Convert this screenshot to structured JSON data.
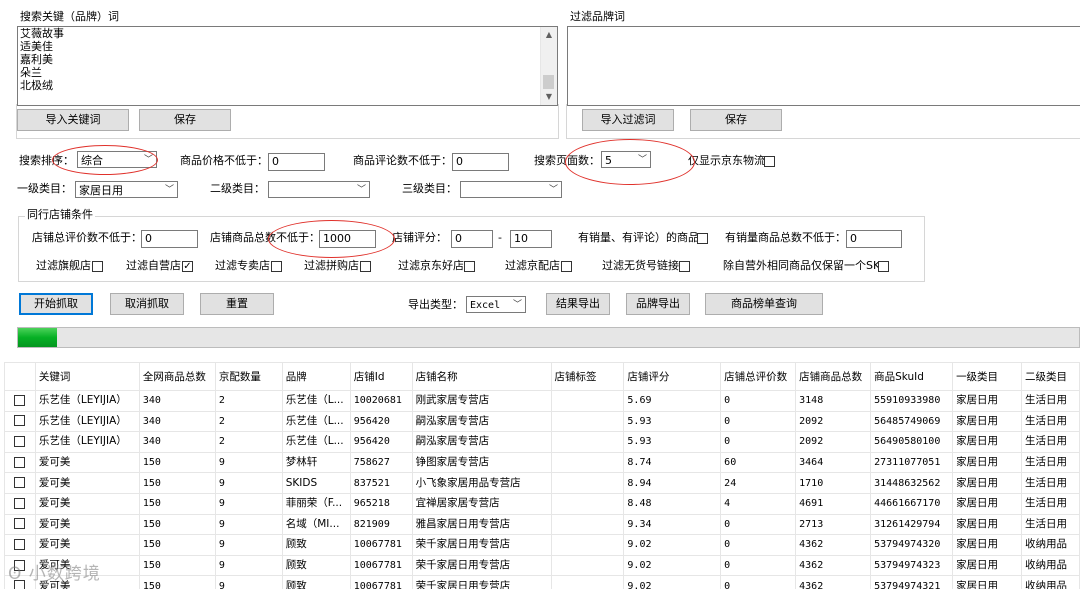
{
  "keywords": {
    "label": "搜索关键（品牌）词",
    "items": [
      "艾薇故事",
      "适美佳",
      "嘉利美",
      "朵兰",
      "北极绒"
    ],
    "import_button": "导入关键词",
    "save_button": "保存"
  },
  "filter_brands": {
    "label": "过滤品牌词",
    "import_button": "导入过滤词",
    "save_button": "保存"
  },
  "search": {
    "sort_label": "搜索排序：",
    "sort_value": "综合",
    "min_price_label": "商品价格不低于：",
    "min_price_value": "0",
    "min_reviews_label": "商品评论数不低于：",
    "min_reviews_value": "0",
    "pages_label": "搜索页面数：",
    "pages_value": "5",
    "jd_logistics_label": "仅显示京东物流"
  },
  "categories": {
    "level1_label": "一级类目：",
    "level1_value": "家居日用",
    "level2_label": "二级类目：",
    "level2_value": "",
    "level3_label": "三级类目：",
    "level3_value": ""
  },
  "peer_shop": {
    "group_label": "同行店铺条件",
    "total_reviews_label": "店铺总评价数不低于：",
    "total_reviews_value": "0",
    "total_products_label": "店铺商品总数不低于：",
    "total_products_value": "1000",
    "score_label": "店铺评分：",
    "score_min": "0",
    "score_sep": "-",
    "score_max": "10",
    "has_sales_label": "有销量、有评论）的商品)",
    "min_sales_products_label": "有销量商品总数不低于：",
    "min_sales_products_value": "0",
    "filters": [
      {
        "label": "过滤旗舰店",
        "checked": false
      },
      {
        "label": "过滤自营店",
        "checked": true
      },
      {
        "label": "过滤专卖店",
        "checked": false
      },
      {
        "label": "过滤拼购店",
        "checked": false
      },
      {
        "label": "过滤京东好店",
        "checked": false
      },
      {
        "label": "过滤京配店",
        "checked": false
      },
      {
        "label": "过滤无货号链接",
        "checked": false
      },
      {
        "label": "除自营外相同商品仅保留一个SKU",
        "checked": false
      }
    ]
  },
  "actions": {
    "start": "开始抓取",
    "cancel": "取消抓取",
    "reset": "重置",
    "export_type_label": "导出类型：",
    "export_type_value": "Excel",
    "export_results": "结果导出",
    "export_brands": "品牌导出",
    "product_list_query": "商品榜单查询"
  },
  "progress": {
    "value": 0.037
  },
  "table": {
    "columns": [
      "",
      "关键词",
      "全网商品总数",
      "京配数量",
      "品牌",
      "店铺Id",
      "店铺名称",
      "店铺标签",
      "店铺评分",
      "店铺总评价数",
      "店铺商品总数",
      "商品SkuId",
      "一级类目",
      "二级类目"
    ],
    "rows": [
      [
        "",
        "乐艺佳（LEYIJIA）",
        "340",
        "2",
        "乐艺佳（L...",
        "10020681",
        "刚武家居专营店",
        "",
        "5.69",
        "0",
        "3148",
        "55910933980",
        "家居日用",
        "生活日用"
      ],
      [
        "",
        "乐艺佳（LEYIJIA）",
        "340",
        "2",
        "乐艺佳（L...",
        "956420",
        "嗣泓家居专营店",
        "",
        "5.93",
        "0",
        "2092",
        "56485749069",
        "家居日用",
        "生活日用"
      ],
      [
        "",
        "乐艺佳（LEYIJIA）",
        "340",
        "2",
        "乐艺佳（L...",
        "956420",
        "嗣泓家居专营店",
        "",
        "5.93",
        "0",
        "2092",
        "56490580100",
        "家居日用",
        "生活日用"
      ],
      [
        "",
        "爱可美",
        "150",
        "9",
        "梦林轩",
        "758627",
        "铮图家居专营店",
        "",
        "8.74",
        "60",
        "3464",
        "27311077051",
        "家居日用",
        "生活日用"
      ],
      [
        "",
        "爱可美",
        "150",
        "9",
        "SKIDS",
        "837521",
        "小飞象家居用品专营店",
        "",
        "8.94",
        "24",
        "1710",
        "31448632562",
        "家居日用",
        "生活日用"
      ],
      [
        "",
        "爱可美",
        "150",
        "9",
        "菲丽荣（F...",
        "965218",
        "宜禅居家居专营店",
        "",
        "8.48",
        "4",
        "4691",
        "44661667170",
        "家居日用",
        "生活日用"
      ],
      [
        "",
        "爱可美",
        "150",
        "9",
        "名域（MI...",
        "821909",
        "雅昌家居日用专营店",
        "",
        "9.34",
        "0",
        "2713",
        "31261429794",
        "家居日用",
        "生活日用"
      ],
      [
        "",
        "爱可美",
        "150",
        "9",
        "顾致",
        "10067781",
        "荣千家居日用专营店",
        "",
        "9.02",
        "0",
        "4362",
        "53794974320",
        "家居日用",
        "收纳用品"
      ],
      [
        "",
        "爱可美",
        "150",
        "9",
        "顾致",
        "10067781",
        "荣千家居日用专营店",
        "",
        "9.02",
        "0",
        "4362",
        "53794974323",
        "家居日用",
        "收纳用品"
      ],
      [
        "",
        "爱可美",
        "150",
        "9",
        "顾致",
        "10067781",
        "荣千家居日用专营店",
        "",
        "9.02",
        "0",
        "4362",
        "53794974321",
        "家居日用",
        "收纳用品"
      ]
    ]
  },
  "watermark": "小数跨境",
  "colors": {
    "highlight_ellipse": "#e0312b",
    "progress_green": "#06b025",
    "focus_border": "#0078d7"
  }
}
